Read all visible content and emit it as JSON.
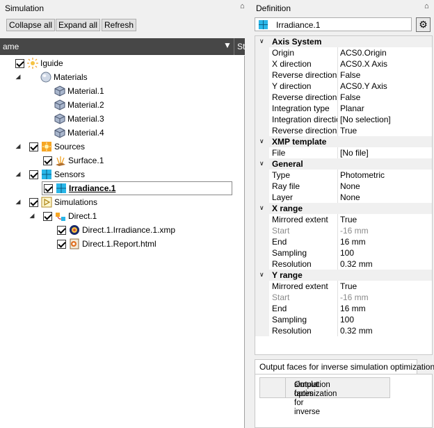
{
  "left_panel": {
    "title": "Simulation",
    "pin": "⌂",
    "toolbar": {
      "collapse_all": "Collapse all",
      "expand_all": "Expand all",
      "refresh": "Refresh"
    },
    "header": {
      "name_col": "ame",
      "filter": "▼",
      "st_col": "St"
    }
  },
  "tree": {
    "root": "Iguide",
    "materials": "Materials",
    "material_items": [
      "Material.1",
      "Material.2",
      "Material.3",
      "Material.4"
    ],
    "sources": "Sources",
    "surface": "Surface.1",
    "sensors": "Sensors",
    "irradiance": "Irradiance.1",
    "simulations": "Simulations",
    "direct": "Direct.1",
    "xmp": "Direct.1.Irradiance.1.xmp",
    "report": "Direct.1.Report.html",
    "expander_glyph": "◢"
  },
  "right_panel": {
    "title": "Definition",
    "pin": "⌂",
    "name_value": "Irradiance.1",
    "settings_glyph": "⚙"
  },
  "grid": {
    "axis_system": "Axis System",
    "origin_label": "Origin",
    "origin_value": "ACS0.Origin",
    "xdir_label": "X direction",
    "xdir_value": "ACS0.X Axis",
    "rev1_label": "Reverse direction",
    "rev1_value": "False",
    "ydir_label": "Y direction",
    "ydir_value": "ACS0.Y Axis",
    "rev2_label": "Reverse direction",
    "rev2_value": "False",
    "itype_label": "Integration type",
    "itype_value": "Planar",
    "idir_label": "Integration direction",
    "idir_value": "[No selection]",
    "rev3_label": "Reverse direction",
    "rev3_value": "True",
    "xmp_template": "XMP template",
    "file_label": "File",
    "file_value": "[No file]",
    "general": "General",
    "type_label": "Type",
    "type_value": "Photometric",
    "rayfile_label": "Ray file",
    "rayfile_value": "None",
    "layer_label": "Layer",
    "layer_value": "None",
    "x_range": "X range",
    "x_mirror_label": "Mirrored extent",
    "x_mirror_value": "True",
    "x_start_label": "Start",
    "x_start_value": "-16 mm",
    "x_end_label": "End",
    "x_end_value": "16 mm",
    "x_sampling_label": "Sampling",
    "x_sampling_value": "100",
    "x_res_label": "Resolution",
    "x_res_value": "0.32 mm",
    "y_range": "Y range",
    "y_mirror_label": "Mirrored extent",
    "y_mirror_value": "True",
    "y_start_label": "Start",
    "y_start_value": "-16 mm",
    "y_end_label": "End",
    "y_end_value": "16 mm",
    "y_sampling_label": "Sampling",
    "y_sampling_value": "100",
    "y_res_label": "Resolution",
    "y_res_value": "0.32 mm",
    "cat_glyph": "∨"
  },
  "bottom": {
    "tab_label": "Output faces for inverse simulation optimization",
    "col_header_line1": "Output faces for inverse",
    "col_header_line2": "simulation optimization"
  }
}
